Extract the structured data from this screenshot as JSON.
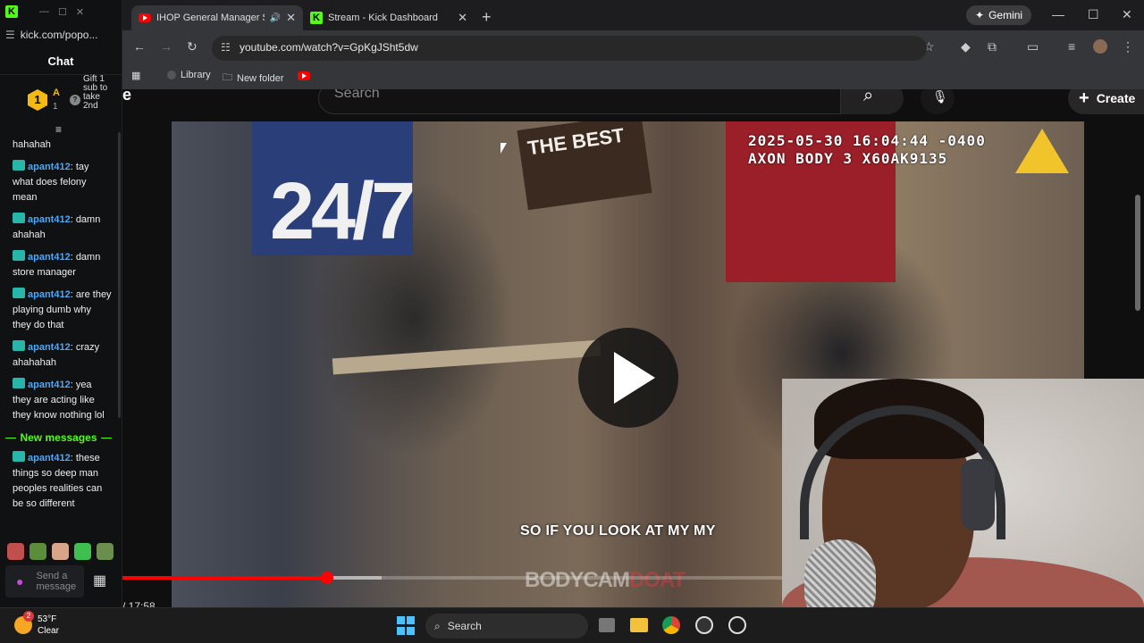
{
  "kick_window": {
    "url": "kick.com/popo...",
    "chat_title": "Chat",
    "gift": {
      "badge_rank": "1",
      "user_letter": "A",
      "count": "1",
      "text": "Gift 1 sub to take 2nd"
    },
    "messages": [
      {
        "user": "",
        "text": "hahahah"
      },
      {
        "user": "apant412",
        "text": ": tay what does felony mean"
      },
      {
        "user": "apant412",
        "text": ": damn ahahah"
      },
      {
        "user": "apant412",
        "text": ": damn store manager"
      },
      {
        "user": "apant412",
        "text": ": are they playing dumb why they do that"
      },
      {
        "user": "apant412",
        "text": ": crazy ahahahah"
      },
      {
        "user": "apant412",
        "text": ": yea they are acting like they know nothing lol"
      }
    ],
    "new_messages_label": "New messages",
    "new_messages": [
      {
        "user": "apant412",
        "text": ": these things so deep man peoples realities can be so different"
      }
    ],
    "input_placeholder": "Send a message"
  },
  "chrome": {
    "tabs": [
      {
        "title": "IHOP General Manager Ste",
        "favicon": "youtube-icon",
        "active": true
      },
      {
        "title": "Stream - Kick Dashboard",
        "favicon": "kick-icon",
        "active": false
      }
    ],
    "gemini_label": "Gemini",
    "url": "youtube.com/watch?v=GpKgJSht5dw",
    "bookmarks": [
      {
        "label": "Library"
      },
      {
        "label": "New folder"
      }
    ]
  },
  "youtube": {
    "search_placeholder": "Search",
    "create_label": "Create",
    "video": {
      "overlay_timestamp_line1": "2025-05-30 16:04:44 -0400",
      "overlay_timestamp_line2": "AXON BODY 3 X60AK9135",
      "caption": "SO IF YOU LOOK AT MY MY",
      "poster_text": "24/7",
      "sign_text": "THE BEST",
      "watermark_a": "BODYCAM",
      "watermark_b": "DOAT"
    },
    "time_label": "/ 17:58",
    "progress_fraction": 0.2
  },
  "taskbar": {
    "weather_temp": "53°F",
    "weather_desc": "Clear",
    "weather_badge": "2",
    "search_label": "Search"
  },
  "colors": {
    "kick_green": "#53fc18",
    "youtube_red": "#ff0000",
    "chat_user": "#4ea8f7"
  }
}
